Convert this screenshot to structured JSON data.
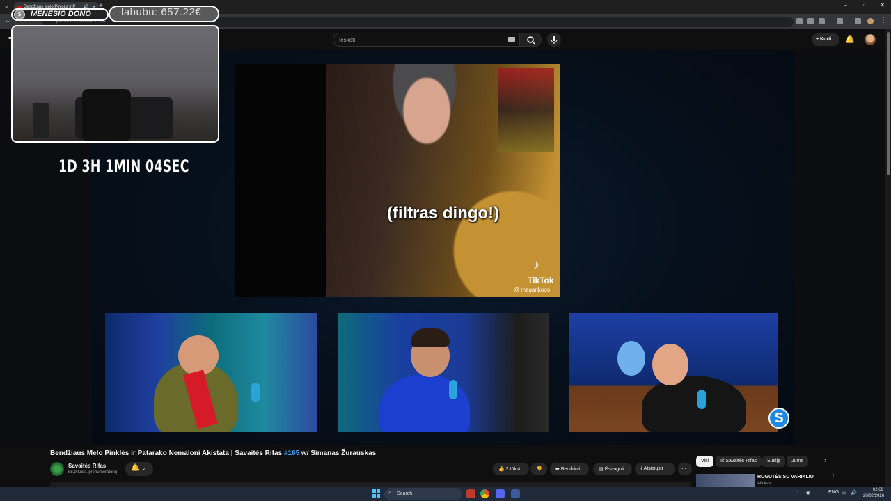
{
  "browser": {
    "tab_title": "Bendžiaus Melo Pinklės ir P",
    "url": "youtube.com/watch?v=...",
    "new_tab": "+",
    "win_min": "–",
    "win_max": "▫",
    "win_close": "✕"
  },
  "youtube": {
    "search_placeholder": "Ieškoti",
    "create_label": "Kurti"
  },
  "overlay": {
    "donation_label": "MENESIO DONO",
    "donation_amount": "labubu: 657.22€",
    "timer": "1D 3H 1MIN 04SEC"
  },
  "video": {
    "caption": "(filtras dingo!)",
    "tiktok_brand": "TikTok",
    "tiktok_handle": "@ megankooo",
    "title_main": "Bendžiaus Melo Pinklės ir Patarako Nemaloni Akistata | Savaitės Rifas ",
    "title_tag": "#165",
    "title_tail": " w/ Simanas Žurauskas",
    "channel_name": "Savaitės Rifas",
    "channel_subs": "58,9 tūkst. prenumeratorių",
    "likes": "2 tūkst.",
    "share": "Bendrinti",
    "save": "Išsaugoti",
    "download": "Atsisiųsti",
    "more": "⋯"
  },
  "sidebar": {
    "chips": [
      "Visi",
      "Iš Savaitės Rifas",
      "Susiję",
      "Jums"
    ],
    "rec_title": "ROGUTĖS SU VARIKLIU",
    "rec_channel": "Aliukas"
  },
  "taskbar": {
    "search_label": "Search",
    "lang": "ENG",
    "time": "02:09",
    "date": "20/02/2026"
  }
}
